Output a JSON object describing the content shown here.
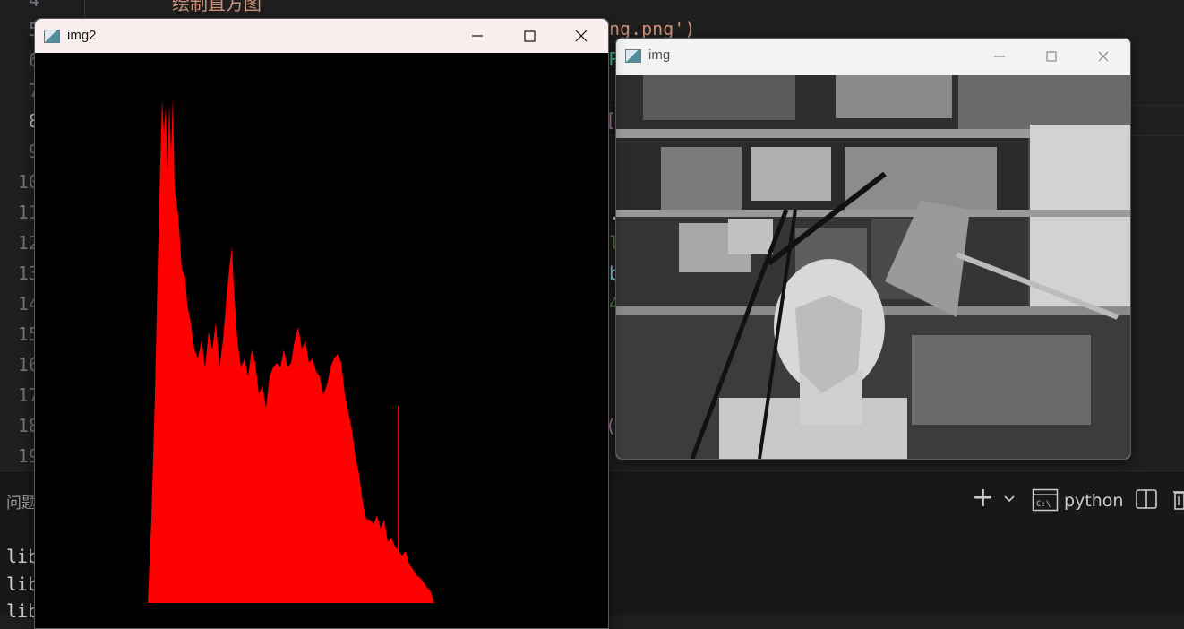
{
  "editor": {
    "line_numbers": [
      "4",
      "5",
      "6",
      "7",
      "8",
      "9",
      "10",
      "11",
      "12",
      "13",
      "14",
      "15",
      "16",
      "17",
      "18",
      "19"
    ],
    "active_line": "8",
    "fragments": [
      {
        "text": "绘制直方图",
        "color": "#ce9178"
      },
      {
        "text": "ng.png')",
        "color": "#ce9178"
      },
      {
        "text": "R",
        "color": "#4ec9b0"
      },
      {
        "text": "[",
        "color": "#c586c0"
      },
      {
        "text": ".",
        "color": "#cccccc"
      },
      {
        "text": "l",
        "color": "#6a9955"
      },
      {
        "text": "b",
        "color": "#9cdcfe"
      },
      {
        "text": "4",
        "color": "#6a9955"
      },
      {
        "text": "(",
        "color": "#c586c0"
      }
    ]
  },
  "panel": {
    "tab_label": "问题",
    "terminal_lines": [
      "lib",
      "lib",
      "lib"
    ],
    "terminal_name": "python",
    "add_label": "+",
    "icons": [
      "add-icon",
      "chevron-down-icon",
      "terminal-icon",
      "split-icon",
      "trash-icon"
    ]
  },
  "window_img2": {
    "title": "img2",
    "icons": [
      "app-icon",
      "minimize-icon",
      "maximize-icon",
      "close-icon"
    ]
  },
  "window_img": {
    "title": "img",
    "icons": [
      "app-icon",
      "minimize-icon",
      "maximize-icon",
      "close-icon"
    ]
  },
  "histogram": {
    "color": "#ff0000",
    "background": "#000000",
    "bin_count": 256,
    "description_keys": [
      "peak-at-low-intensity",
      "secondary-peak",
      "tall-spike-near-mid"
    ]
  },
  "colors": {
    "editor_bg": "#1f1f1f",
    "panel_bg": "#181818",
    "titlebar_active": "#f8eeee",
    "titlebar_inactive": "#f3f3f3"
  }
}
